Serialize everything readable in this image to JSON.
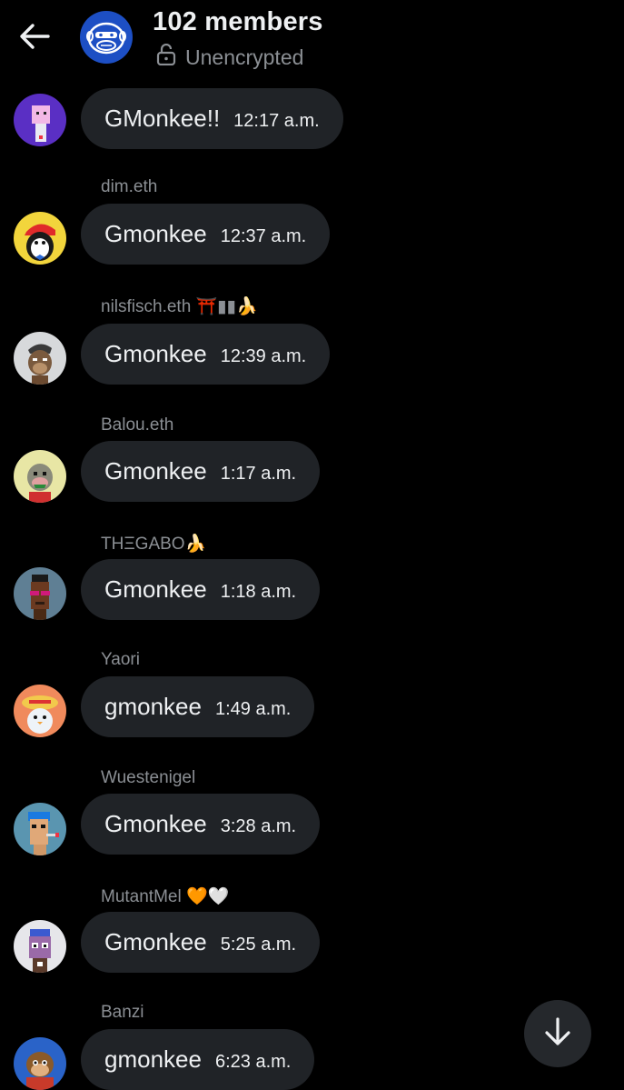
{
  "header": {
    "title": "102 members",
    "encryption_status": "Unencrypted",
    "back_icon": "arrow-left-icon",
    "lock_icon": "unlocked-padlock-icon",
    "group_avatar_icon": "monkey-face-icon",
    "accent": "#1d4fc4"
  },
  "messages": [
    {
      "sender": "",
      "text": "GMonkee!!",
      "time": "12:17 a.m.",
      "avatar_color": "#5a2fc4"
    },
    {
      "sender": "dim.eth",
      "text": "Gmonkee",
      "time": "12:37 a.m.",
      "avatar_color": "#f2d53c"
    },
    {
      "sender": "nilsfisch.eth ⛩️▮▮🍌",
      "text": "Gmonkee",
      "time": "12:39 a.m.",
      "avatar_color": "#d7d9db"
    },
    {
      "sender": "Balou.eth",
      "text": "Gmonkee",
      "time": "1:17 a.m.",
      "avatar_color": "#e8e6a5"
    },
    {
      "sender": "THΞGABO🍌",
      "text": "Gmonkee",
      "time": "1:18 a.m.",
      "avatar_color": "#5f7f94"
    },
    {
      "sender": "Yaori",
      "text": "gmonkee",
      "time": "1:49 a.m.",
      "avatar_color": "#f08a5c"
    },
    {
      "sender": "Wuestenigel",
      "text": "Gmonkee",
      "time": "3:28 a.m.",
      "avatar_color": "#5a95b0"
    },
    {
      "sender": "MutantMel 🧡🤍",
      "text": "Gmonkee",
      "time": "5:25 a.m.",
      "avatar_color": "#e6e6ea"
    },
    {
      "sender": "Banzi",
      "text": "gmonkee",
      "time": "6:23 a.m.",
      "avatar_color": "#2a63c8"
    }
  ],
  "scroll_button": {
    "icon": "arrow-down-icon"
  }
}
